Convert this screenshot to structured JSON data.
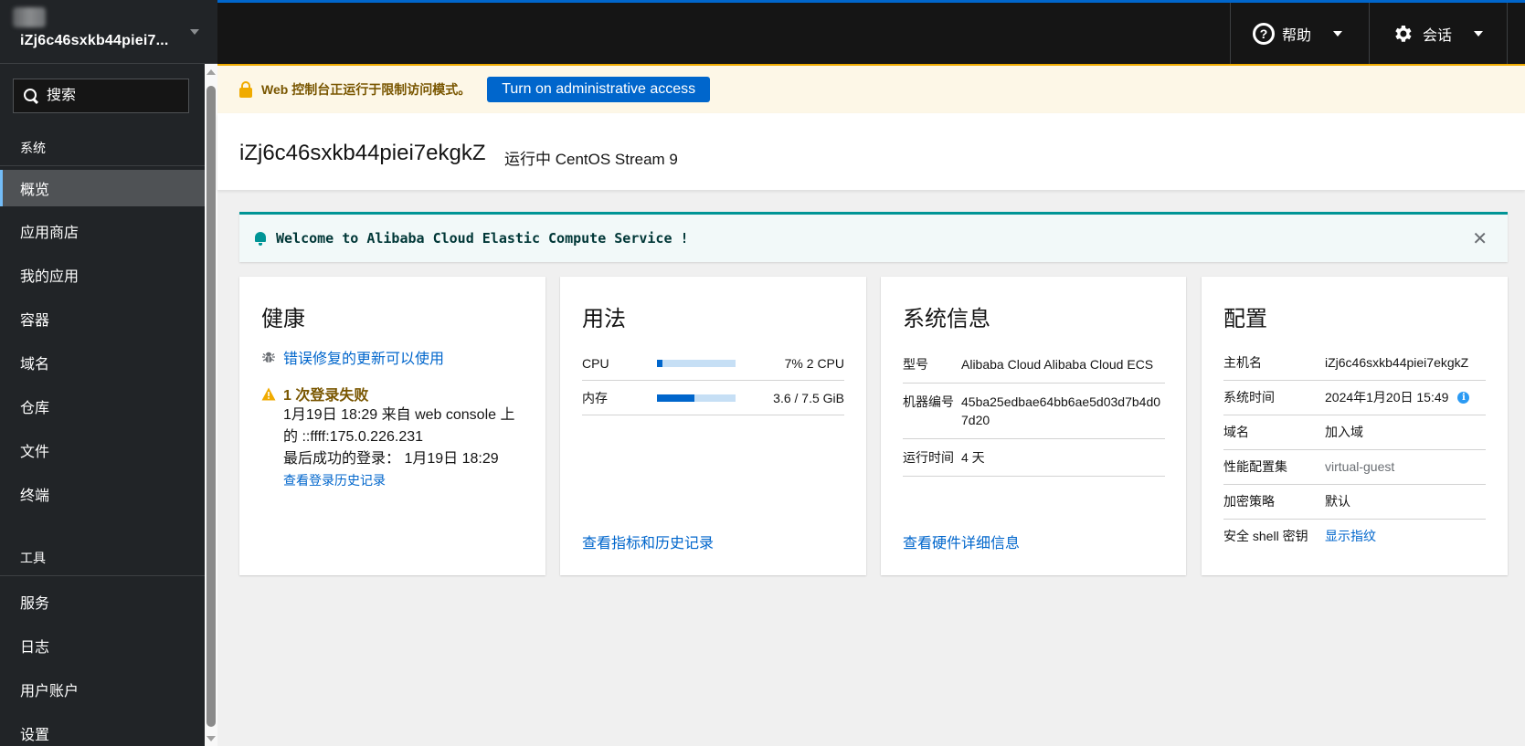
{
  "sidebar": {
    "host_name": "iZj6c46sxkb44piei7...",
    "search_placeholder": "搜索",
    "section_system": "系统",
    "items_system": [
      {
        "label": "概览",
        "active": true
      },
      {
        "label": "应用商店"
      },
      {
        "label": "我的应用"
      },
      {
        "label": "容器"
      },
      {
        "label": "域名"
      },
      {
        "label": "仓库"
      },
      {
        "label": "文件"
      },
      {
        "label": "终端"
      }
    ],
    "section_tools": "工具",
    "items_tools": [
      {
        "label": "服务"
      },
      {
        "label": "日志"
      },
      {
        "label": "用户账户"
      },
      {
        "label": "设置"
      }
    ]
  },
  "topbar": {
    "help_label": "帮助",
    "session_label": "会话",
    "accent_color": "#0066cc"
  },
  "limited_access": {
    "message": "Web 控制台正运行于限制访问模式。",
    "button_label": "Turn on administrative access"
  },
  "page_header": {
    "title": "iZj6c46sxkb44piei7ekgkZ",
    "subtitle": "运行中 CentOS Stream 9"
  },
  "welcome": {
    "message": "Welcome to Alibaba Cloud Elastic Compute Service !"
  },
  "health": {
    "title": "健康",
    "update_link": "错误修复的更新可以使用",
    "failed_login_title": "1 次登录失败",
    "failed_login_detail_1": "1月19日 18:29 来自 web console 上",
    "failed_login_detail_2": "的 ::ffff:175.0.226.231",
    "last_success": "最后成功的登录： 1月19日 18:29",
    "history_link": "查看登录历史记录"
  },
  "usage": {
    "title": "用法",
    "rows": [
      {
        "label": "CPU",
        "value": "7% 2 CPU",
        "fraction": 0.07
      },
      {
        "label": "内存",
        "value": "3.6 / 7.5 GiB",
        "fraction": 0.48
      }
    ],
    "footer_link": "查看指标和历史记录"
  },
  "system_info": {
    "title": "系统信息",
    "rows": [
      {
        "key": "型号",
        "value": "Alibaba Cloud Alibaba Cloud ECS"
      },
      {
        "key": "机器编号",
        "value": "45ba25edbae64bb6ae5d03d7b4d07d20"
      },
      {
        "key": "运行时间",
        "value": "4 天"
      }
    ],
    "footer_link": "查看硬件详细信息"
  },
  "configuration": {
    "title": "配置",
    "rows": [
      {
        "key": "主机名",
        "value": "iZj6c46sxkb44piei7ekgkZ"
      },
      {
        "key": "系统时间",
        "value": "2024年1月20日 15:49"
      },
      {
        "key": "域名",
        "value": "加入域"
      },
      {
        "key": "性能配置集",
        "value": "virtual-guest"
      },
      {
        "key": "加密策略",
        "value": "默认"
      },
      {
        "key": "安全 shell 密钥",
        "value": "显示指纹"
      }
    ]
  }
}
